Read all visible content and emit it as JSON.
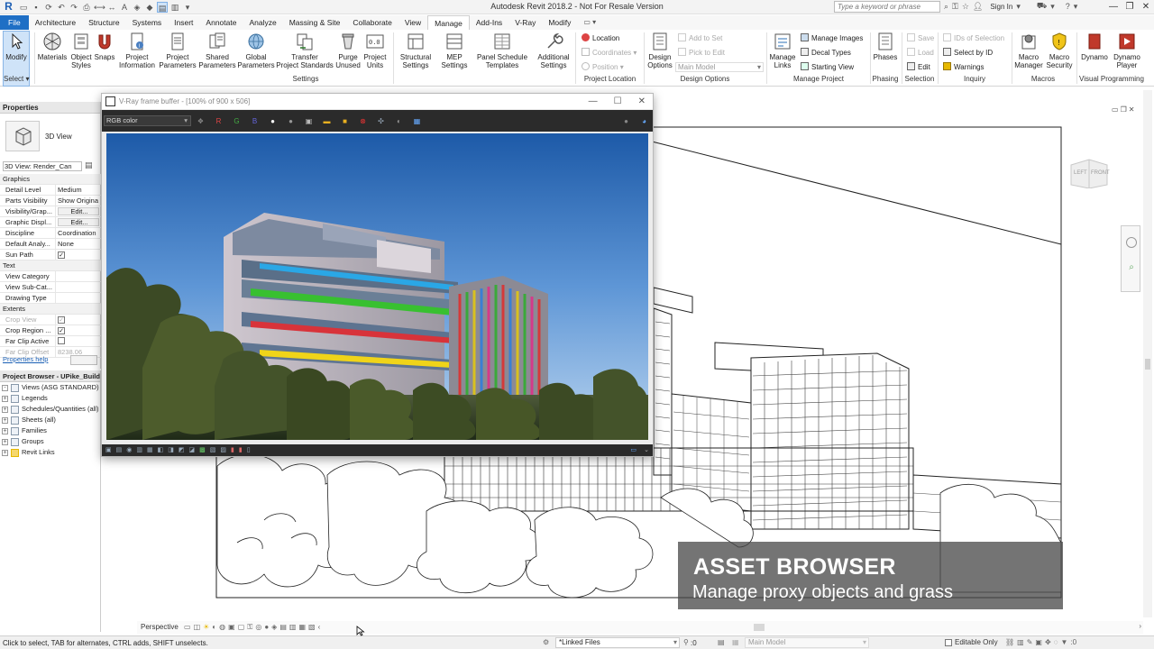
{
  "app": {
    "title": "Autodesk Revit 2018.2 - Not For Resale Version",
    "search_placeholder": "Type a keyword or phrase",
    "sign_in": "Sign In"
  },
  "ribbon_tabs": [
    "File",
    "Architecture",
    "Structure",
    "Systems",
    "Insert",
    "Annotate",
    "Analyze",
    "Massing & Site",
    "Collaborate",
    "View",
    "Manage",
    "Add-Ins",
    "V-Ray",
    "Modify"
  ],
  "active_tab_index": 10,
  "ribbon": {
    "modify": "Modify",
    "select": "Select",
    "settings": {
      "materials": "Materials",
      "object_styles_1": "Object",
      "object_styles_2": "Styles",
      "snaps": "Snaps",
      "project_information_1": "Project",
      "project_information_2": "Information",
      "project_parameters_1": "Project",
      "project_parameters_2": "Parameters",
      "shared_parameters_1": "Shared",
      "shared_parameters_2": "Parameters",
      "global_parameters_1": "Global",
      "global_parameters_2": "Parameters",
      "transfer_1": "Transfer",
      "transfer_2": "Project Standards",
      "purge_1": "Purge",
      "purge_2": "Unused",
      "project_units_1": "Project",
      "project_units_2": "Units",
      "structural_1": "Structural",
      "structural_2": "Settings",
      "mep_1": "MEP",
      "mep_2": "Settings",
      "panel_1": "Panel Schedule",
      "panel_2": "Templates",
      "additional_1": "Additional",
      "additional_2": "Settings",
      "group_label": "Settings"
    },
    "project_location": {
      "location": "Location",
      "coordinates": "Coordinates",
      "position": "Position",
      "group_label": "Project Location"
    },
    "design_options": {
      "design_options_1": "Design",
      "design_options_2": "Options",
      "add_to_set": "Add to Set",
      "pick_to_edit": "Pick to Edit",
      "main_model": "Main Model",
      "group_label": "Design Options"
    },
    "manage_project": {
      "manage_links_1": "Manage",
      "manage_links_2": "Links",
      "manage_images": "Manage Images",
      "decal_types": "Decal Types",
      "starting_view": "Starting View",
      "group_label": "Manage Project"
    },
    "phasing": {
      "phases": "Phases",
      "group_label": "Phasing"
    },
    "selection": {
      "save": "Save",
      "load": "Load",
      "edit": "Edit",
      "group_label": "Selection"
    },
    "inquiry": {
      "ids_of_selection": "IDs of Selection",
      "select_by_id": "Select by ID",
      "warnings": "Warnings",
      "group_label": "Inquiry"
    },
    "macros": {
      "macro_manager_1": "Macro",
      "macro_manager_2": "Manager",
      "macro_security_1": "Macro",
      "macro_security_2": "Security",
      "group_label": "Macros"
    },
    "visual_programming": {
      "dynamo": "Dynamo",
      "dynamo_player_1": "Dynamo",
      "dynamo_player_2": "Player",
      "group_label": "Visual Programming"
    }
  },
  "properties": {
    "header": "Properties",
    "type_name": "3D View",
    "view_selector": "3D View: Render_Can",
    "rows": [
      {
        "cat": true,
        "k": "Graphics"
      },
      {
        "k": "Detail Level",
        "v": "Medium"
      },
      {
        "k": "Parts Visibility",
        "v": "Show Origina"
      },
      {
        "k": "Visibility/Grap...",
        "v": "Edit...",
        "btn": true
      },
      {
        "k": "Graphic Displ...",
        "v": "Edit...",
        "btn": true
      },
      {
        "k": "Discipline",
        "v": "Coordination"
      },
      {
        "k": "Default Analy...",
        "v": "None"
      },
      {
        "k": "Sun Path",
        "v": "✓",
        "check": true
      },
      {
        "cat": true,
        "k": "Text"
      },
      {
        "k": "View Category",
        "v": ""
      },
      {
        "k": "View Sub-Cat...",
        "v": ""
      },
      {
        "k": "Drawing Type",
        "v": ""
      },
      {
        "cat": true,
        "k": "Extents"
      },
      {
        "k": "Crop View",
        "v": "✓",
        "check": true,
        "dim": true
      },
      {
        "k": "Crop Region ...",
        "v": "✓",
        "check": true
      },
      {
        "k": "Far Clip Active",
        "v": "",
        "check": true
      },
      {
        "k": "Far Clip Offset",
        "v": "8238.06",
        "dim": true
      }
    ],
    "help_link": "Properties help"
  },
  "browser": {
    "header": "Project Browser - UPike_Building",
    "items": [
      {
        "label": "Views (ASG STANDARD)",
        "exp": "-"
      },
      {
        "label": "Legends",
        "exp": "+"
      },
      {
        "label": "Schedules/Quantities (all)",
        "exp": "+"
      },
      {
        "label": "Sheets (all)",
        "exp": "+"
      },
      {
        "label": "Families",
        "exp": "+"
      },
      {
        "label": "Groups",
        "exp": "+"
      },
      {
        "label": "Revit Links",
        "exp": "+"
      }
    ]
  },
  "vray": {
    "title": "V-Ray frame buffer - [100% of 900 x 506]",
    "channel": "RGB color",
    "channel_buttons": [
      "R",
      "G",
      "B"
    ]
  },
  "viewcube": {
    "left": "LEFT",
    "front": "FRONT"
  },
  "caption": {
    "title": "ASSET BROWSER",
    "subtitle": "Manage proxy objects and grass"
  },
  "view_control": {
    "perspective": "Perspective"
  },
  "status": {
    "text": "Click to select, TAB for alternates, CTRL adds, SHIFT unselects.",
    "workset": "*Linked Files",
    "workset_count": ":0",
    "design_option": "Main Model",
    "editable_only": "Editable Only"
  }
}
